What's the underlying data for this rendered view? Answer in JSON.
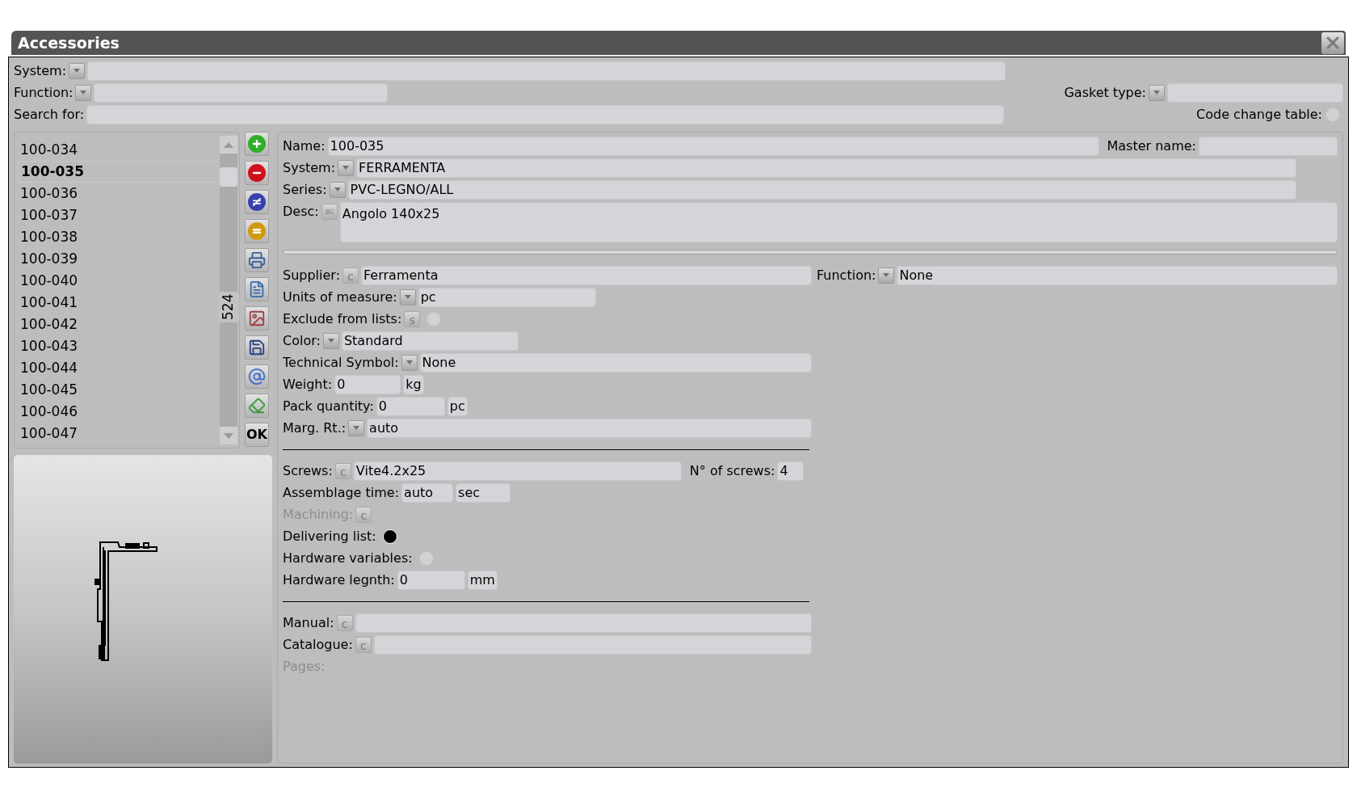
{
  "window": {
    "title": "Accessories"
  },
  "filters": {
    "system": {
      "label": "System:"
    },
    "function": {
      "label": "Function:"
    },
    "search": {
      "label": "Search for:"
    },
    "gasket_type": {
      "label": "Gasket type:"
    },
    "code_change_table": {
      "label": "Code change table:",
      "checked": false
    }
  },
  "list": {
    "count": "524",
    "items": [
      {
        "label": "100-034",
        "selected": false
      },
      {
        "label": "100-035",
        "selected": true
      },
      {
        "label": "100-036",
        "selected": false
      },
      {
        "label": "100-037",
        "selected": false
      },
      {
        "label": "100-038",
        "selected": false
      },
      {
        "label": "100-039",
        "selected": false
      },
      {
        "label": "100-040",
        "selected": false
      },
      {
        "label": "100-041",
        "selected": false
      },
      {
        "label": "100-042",
        "selected": false
      },
      {
        "label": "100-043",
        "selected": false
      },
      {
        "label": "100-044",
        "selected": false
      },
      {
        "label": "100-045",
        "selected": false
      },
      {
        "label": "100-046",
        "selected": false
      },
      {
        "label": "100-047",
        "selected": false
      }
    ]
  },
  "toolbar": {
    "buttons": [
      {
        "kind": "add"
      },
      {
        "kind": "remove"
      },
      {
        "kind": "differ"
      },
      {
        "kind": "equal"
      },
      {
        "kind": "print"
      },
      {
        "kind": "report"
      },
      {
        "kind": "graphics"
      },
      {
        "kind": "save"
      },
      {
        "kind": "email"
      },
      {
        "kind": "erase"
      },
      {
        "kind": "ok",
        "label": "OK"
      }
    ]
  },
  "detail": {
    "name": {
      "label": "Name:",
      "value": "100-035"
    },
    "master_name": {
      "label": "Master name:"
    },
    "system": {
      "label": "System:",
      "value": "FERRAMENTA"
    },
    "series": {
      "label": "Series:",
      "value": "PVC-LEGNO/ALL"
    },
    "desc": {
      "label": "Desc:",
      "value": "Angolo 140x25"
    },
    "supplier": {
      "label": "Supplier:",
      "button": "c",
      "value": "Ferramenta"
    },
    "function": {
      "label": "Function:",
      "value": "None"
    },
    "units": {
      "label": "Units of measure:",
      "value": "pc"
    },
    "exclude": {
      "label": "Exclude from lists:",
      "button": "s",
      "checked": false
    },
    "color": {
      "label": "Color:",
      "value": "Standard"
    },
    "technical_symbol": {
      "label": "Technical Symbol:",
      "value": "None"
    },
    "weight": {
      "label": "Weight:",
      "value": "0",
      "unit": "kg"
    },
    "pack_quantity": {
      "label": "Pack quantity:",
      "value": "0",
      "unit": "pc"
    },
    "marg_rt": {
      "label": "Marg. Rt.:",
      "value": "auto"
    },
    "screws": {
      "label": "Screws:",
      "button": "c",
      "value": "Vite4.2x25"
    },
    "n_screws": {
      "label": "N° of screws:",
      "value": "4"
    },
    "assemblage_time": {
      "label": "Assemblage time:",
      "value": "auto",
      "unit": "sec"
    },
    "machining": {
      "label": "Machining:",
      "button": "c",
      "disabled": true
    },
    "delivering_list": {
      "label": "Delivering list:",
      "checked": true
    },
    "hardware_variables": {
      "label": "Hardware variables:",
      "checked": false
    },
    "hardware_length": {
      "label": "Hardware legnth:",
      "value": "0",
      "unit": "mm"
    },
    "manual": {
      "label": "Manual:",
      "button": "c"
    },
    "catalogue": {
      "label": "Catalogue:",
      "button": "c"
    },
    "pages": {
      "label": "Pages:",
      "disabled": true
    }
  }
}
